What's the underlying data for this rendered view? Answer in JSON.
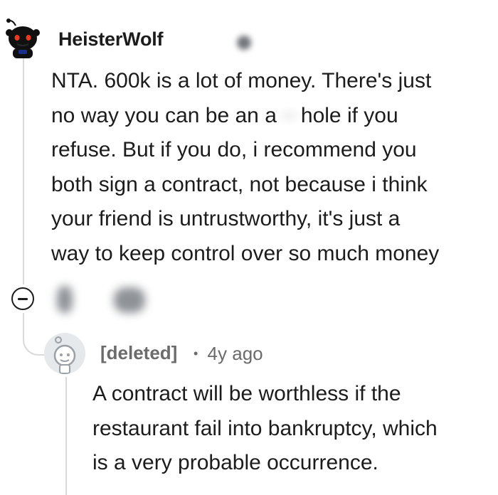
{
  "comment": {
    "username": "HeisterWolf",
    "body_lines": [
      "NTA. 600k is a lot of money. There's just",
      "no way you can be an a",
      "hole if you",
      "refuse. But if you do, i recommend you",
      "both sign a contract, not because i think",
      "your friend is untrustworthy, it's just a",
      "way to keep control over so much money"
    ]
  },
  "reply": {
    "username": "[deleted]",
    "separator": "•",
    "age": "4y ago",
    "body_lines": [
      "A contract will be worthless if the",
      "restaurant fail into bankruptcy, which",
      "is a very probable occurrence."
    ]
  }
}
